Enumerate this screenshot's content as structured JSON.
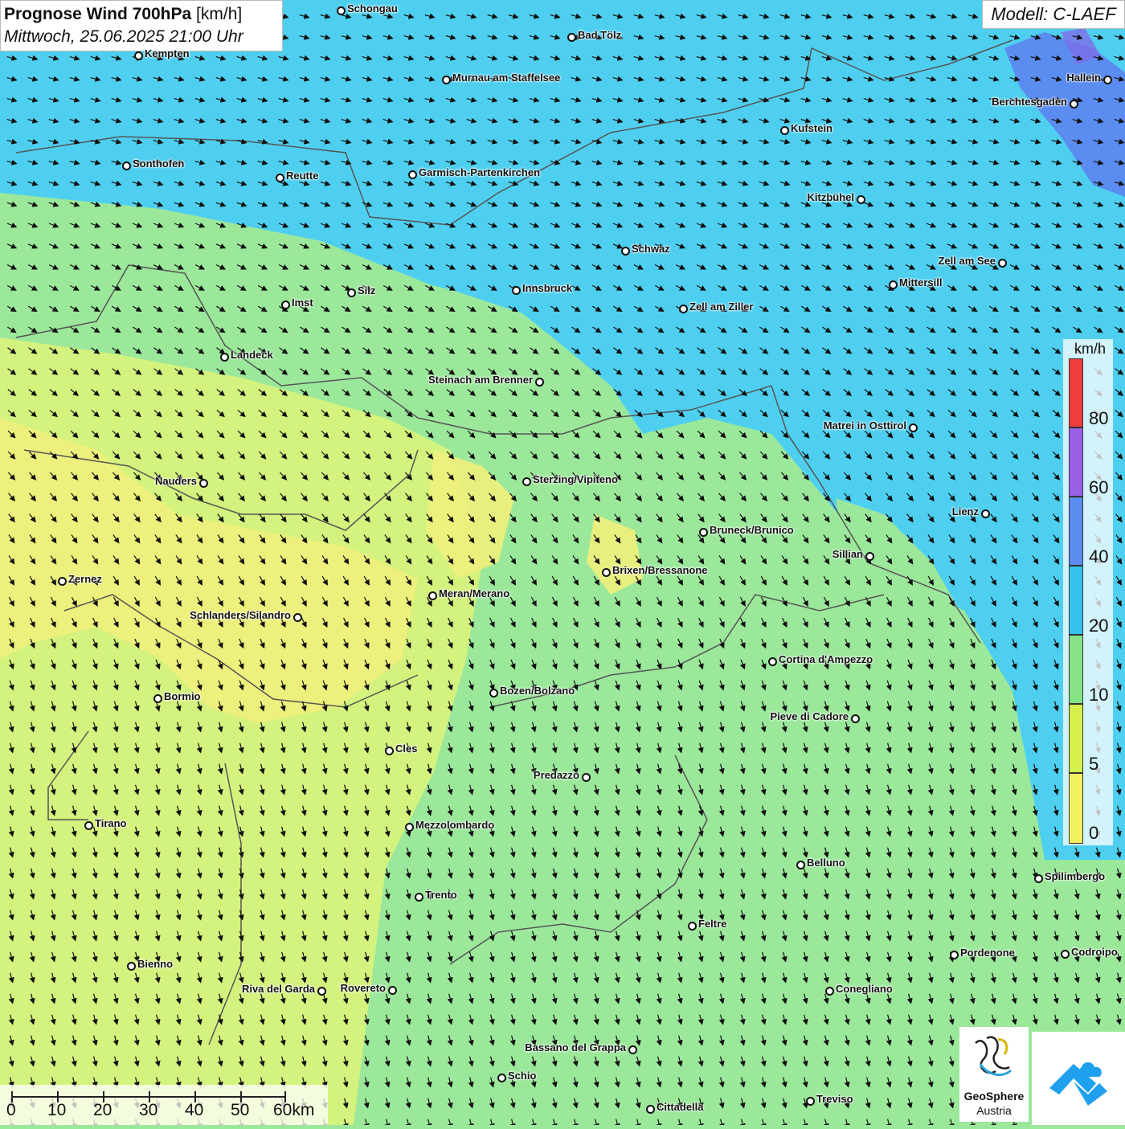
{
  "title": {
    "bold": "Prognose Wind 700hPa",
    "unit": "[km/h]",
    "date": "Mittwoch, 25.06.2025 21:00 Uhr"
  },
  "model": "Modell: C-LAEF",
  "colors": {
    "yellow": "#f3f27a",
    "lime": "#d6f27c",
    "green": "#9be89b",
    "cyan": "#4fd0f0",
    "blue": "#5b8cf0",
    "purple": "#9a60e8",
    "red": "#f04040"
  },
  "cities": [
    {
      "name": "Schongau"
    },
    {
      "name": "Bad Tölz"
    },
    {
      "name": "Kempten"
    },
    {
      "name": "Murnau am Staffelsee"
    },
    {
      "name": "Hallein"
    },
    {
      "name": "Berchtesgaden"
    },
    {
      "name": "Kufstein"
    },
    {
      "name": "Sonthofen"
    },
    {
      "name": "Reutte"
    },
    {
      "name": "Garmisch-Partenkirchen"
    },
    {
      "name": "Kitzbühel"
    },
    {
      "name": "Schwaz"
    },
    {
      "name": "Zell am See"
    },
    {
      "name": "Innsbruck"
    },
    {
      "name": "Mittersill"
    },
    {
      "name": "Silz"
    },
    {
      "name": "Imst"
    },
    {
      "name": "Zell am Ziller"
    },
    {
      "name": "Landeck"
    },
    {
      "name": "Steinach am Brenner"
    },
    {
      "name": "Matrei in Osttirol"
    },
    {
      "name": "Nauders"
    },
    {
      "name": "Sterzing/Vipiteno"
    },
    {
      "name": "Lienz"
    },
    {
      "name": "Bruneck/Brunico"
    },
    {
      "name": "Sillian"
    },
    {
      "name": "Brixen/Bressanone"
    },
    {
      "name": "Zernez"
    },
    {
      "name": "Meran/Merano"
    },
    {
      "name": "Schlanders/Silandro"
    },
    {
      "name": "Cortina d'Ampezzo"
    },
    {
      "name": "Bozen/Bolzano"
    },
    {
      "name": "Bormio"
    },
    {
      "name": "Pieve di Cadore"
    },
    {
      "name": "Cles"
    },
    {
      "name": "Predazzo"
    },
    {
      "name": "Tirano"
    },
    {
      "name": "Mezzolombardo"
    },
    {
      "name": "Belluno"
    },
    {
      "name": "Spilimbergo"
    },
    {
      "name": "Trento"
    },
    {
      "name": "Feltre"
    },
    {
      "name": "Pordenone"
    },
    {
      "name": "Codroipo"
    },
    {
      "name": "Bienno"
    },
    {
      "name": "Riva del Garda"
    },
    {
      "name": "Rovereto"
    },
    {
      "name": "Conegliano"
    },
    {
      "name": "Bassano del Grappa"
    },
    {
      "name": "Schio"
    },
    {
      "name": "Treviso"
    },
    {
      "name": "Cittadella"
    }
  ],
  "legend": {
    "unit": "km/h",
    "ticks": [
      "80",
      "60",
      "40",
      "20",
      "10",
      "5",
      "0"
    ]
  },
  "scalebar": {
    "labels": [
      "0",
      "10",
      "20",
      "30",
      "40",
      "50",
      "60km"
    ]
  },
  "logos": {
    "geosphere_line1": "GeoSphere",
    "geosphere_line2": "Austria"
  }
}
